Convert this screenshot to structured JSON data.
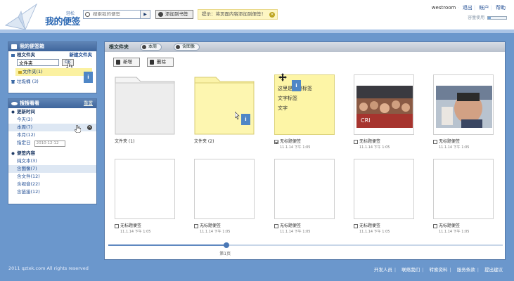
{
  "header": {
    "logo_small": "轻松",
    "logo_text": "我的便签",
    "search_placeholder": "搜索我的便签",
    "search_go": "▶",
    "add_tag_label": "添加到书签",
    "tip_text": "提示：将页面内容添加到便签！",
    "user": "westroom",
    "links": [
      "退出",
      "帐户",
      "帮助"
    ],
    "capacity_label": "容量使用",
    "capacity_used": 0.15
  },
  "left_panel_tags": {
    "title": "我的便签箱",
    "section": "根文件夹",
    "new_folder": "新建文件夹",
    "folder_input": "文件夹",
    "ok": "OK",
    "folder_item": "文件夹(1)",
    "trash": "垃圾桶 (3)"
  },
  "left_panel_search": {
    "title": "搜搜看看",
    "reset": "重置",
    "time_section": "更新时间",
    "time_items": [
      "今天(3)",
      "本周(7)",
      "本月(12)"
    ],
    "date_label": "指定日",
    "date_value": "2010-12-12",
    "content_section": "便签内容",
    "content_items": [
      "纯文本(3)",
      "含图像(7)",
      "含文件(12)",
      "含视音(22)",
      "含链接(12)"
    ]
  },
  "main": {
    "breadcrumb": "根文件夹",
    "tab1": "本周",
    "tab2": "含图像",
    "btn_new": "新增",
    "btn_delete": "删除",
    "note_text": [
      "这里是一段标签",
      "文字标签",
      "文字"
    ],
    "cards": [
      {
        "title": "文件夹 (1)",
        "date": ""
      },
      {
        "title": "文件夹 (2)",
        "date": ""
      },
      {
        "title": "无标题便签",
        "date": "11.1.14 下午 1:05",
        "checked": true
      },
      {
        "title": "无标题便签",
        "date": "11.1.14 下午 1:05"
      },
      {
        "title": "无标题便签",
        "date": "11.1.14 下午 1:05"
      },
      {
        "title": "无标题便签",
        "date": "11.1.14 下午 1:05"
      },
      {
        "title": "无标题便签",
        "date": "11.1.14 下午 1:05"
      },
      {
        "title": "无标题便签",
        "date": "11.1.14 下午 1:05"
      },
      {
        "title": "无标题便签",
        "date": "11.1.14 下午 1:05"
      },
      {
        "title": "无标题便签",
        "date": "11.1.14 下午 1:05"
      }
    ],
    "page_label": "第1页",
    "page_progress": 0.3
  },
  "footer": {
    "copyright": "2011 qztek.com All rights reserved",
    "links": [
      "开发人员",
      "联络我们",
      "转索资料",
      "服务条款",
      "提出建议"
    ]
  },
  "colors": {
    "accent": "#4f86c6",
    "background": "#6b97cc",
    "note_yellow": "#fdf5a6"
  }
}
